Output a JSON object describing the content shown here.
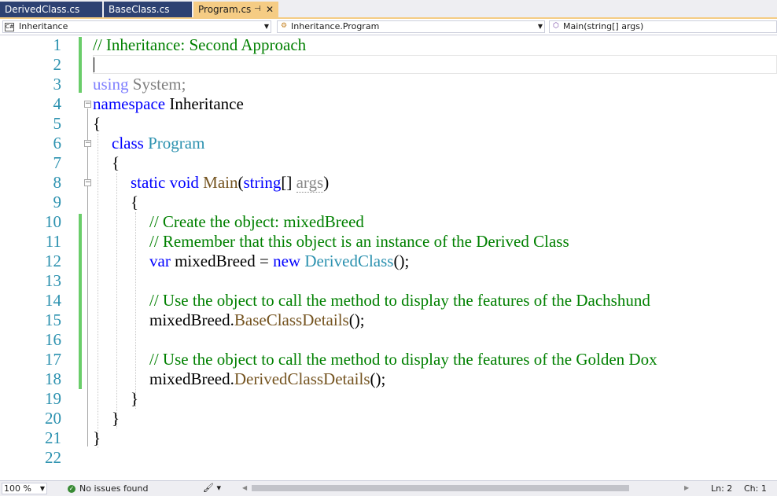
{
  "tabs": [
    {
      "label": "DerivedClass.cs"
    },
    {
      "label": "BaseClass.cs"
    },
    {
      "label": "Program.cs",
      "active": true
    }
  ],
  "nav": {
    "project": "Inheritance",
    "type": "Inheritance.Program",
    "member": "Main(string[] args)"
  },
  "line_numbers": [
    "1",
    "2",
    "3",
    "4",
    "5",
    "6",
    "7",
    "8",
    "9",
    "10",
    "11",
    "12",
    "13",
    "14",
    "15",
    "16",
    "17",
    "18",
    "19",
    "20",
    "21",
    "22"
  ],
  "code": {
    "l1": "// Inheritance: Second Approach",
    "l3_kw": "using",
    "l3_rest": " System;",
    "l4_kw": "namespace",
    "l4_rest": " Inheritance",
    "l5": "{",
    "l6_kw": "class",
    "l6_type": "Program",
    "l7": "{",
    "l8_kw1": "static",
    "l8_kw2": "void",
    "l8_method": "Main",
    "l8_paren": "(",
    "l8_kw3": "string",
    "l8_brackets": "[] ",
    "l8_param": "args",
    "l8_close": ")",
    "l9": "{",
    "l10": "// Create the object: mixedBreed",
    "l11": "// Remember that this object is an instance of the Derived Class",
    "l12_kw": "var",
    "l12_mid": " mixedBreed = ",
    "l12_new": "new",
    "l12_type": "DerivedClass",
    "l12_end": "();",
    "l14": "// Use the object to call the method to display the features of the Dachshund",
    "l15_obj": "mixedBreed.",
    "l15_method": "BaseClassDetails",
    "l15_end": "();",
    "l17": "// Use the object to call the method to display the features of the Golden Dox",
    "l18_obj": "mixedBreed.",
    "l18_method": "DerivedClassDetails",
    "l18_end": "();",
    "l19": "}",
    "l20": "}",
    "l21": "}"
  },
  "status": {
    "zoom": "100 %",
    "issues": "No issues found",
    "line": "Ln: 2",
    "col": "Ch: 1"
  },
  "colors": {
    "keyword": "#0000ff",
    "type": "#2b91af",
    "comment": "#008000",
    "method": "#74531f",
    "tab_active": "#f5cc84",
    "tab_inactive": "#2d4172",
    "change_marker": "#6acd6a"
  },
  "icons": [
    "csharp-project-icon",
    "class-icon",
    "method-icon",
    "check-icon",
    "brush-icon",
    "pin-icon",
    "close-icon"
  ]
}
